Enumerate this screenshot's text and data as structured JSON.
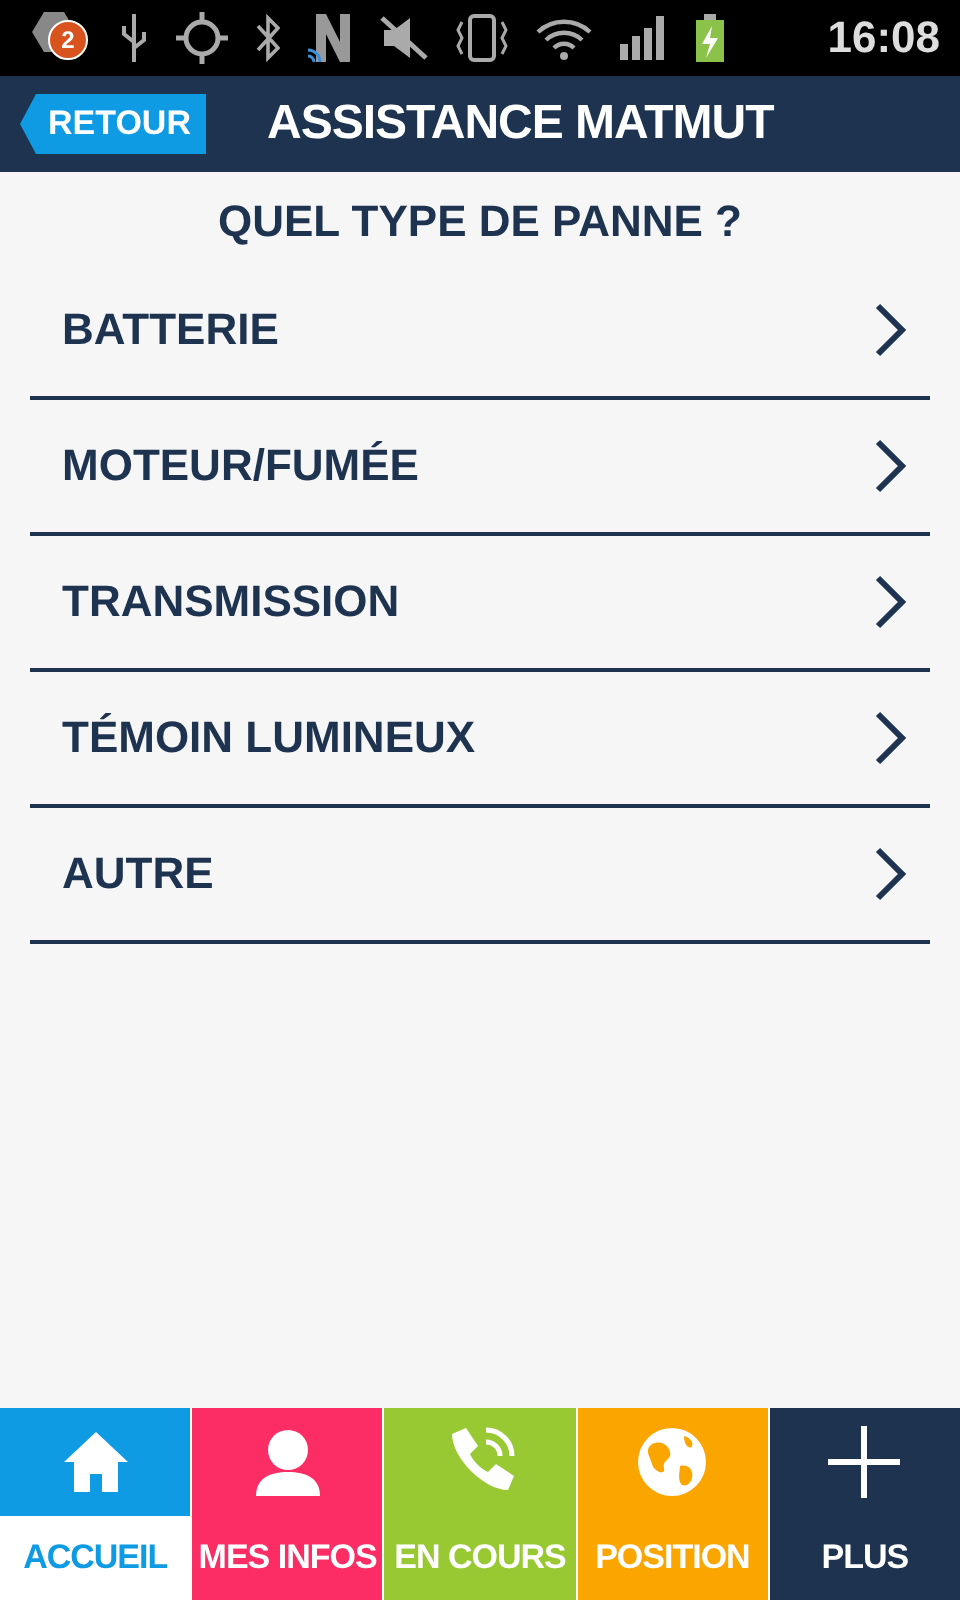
{
  "status_bar": {
    "notification_count": "2",
    "time": "16:08"
  },
  "header": {
    "back_label": "RETOUR",
    "title": "ASSISTANCE MATMUT"
  },
  "question": "QUEL TYPE DE PANNE ?",
  "options": [
    {
      "label": "BATTERIE"
    },
    {
      "label": "MOTEUR/FUMÉE"
    },
    {
      "label": "TRANSMISSION"
    },
    {
      "label": "TÉMOIN LUMINEUX"
    },
    {
      "label": "AUTRE"
    }
  ],
  "nav": [
    {
      "label": "ACCUEIL",
      "kind": "home",
      "color": "#0f9be3",
      "selected": true
    },
    {
      "label": "MES INFOS",
      "kind": "person",
      "color": "#fb2d64",
      "selected": false
    },
    {
      "label": "EN COURS",
      "kind": "phone",
      "color": "#98c933",
      "selected": false
    },
    {
      "label": "POSITION",
      "kind": "globe",
      "color": "#fba500",
      "selected": false
    },
    {
      "label": "PLUS",
      "kind": "plus",
      "color": "#1e3350",
      "selected": false
    }
  ]
}
